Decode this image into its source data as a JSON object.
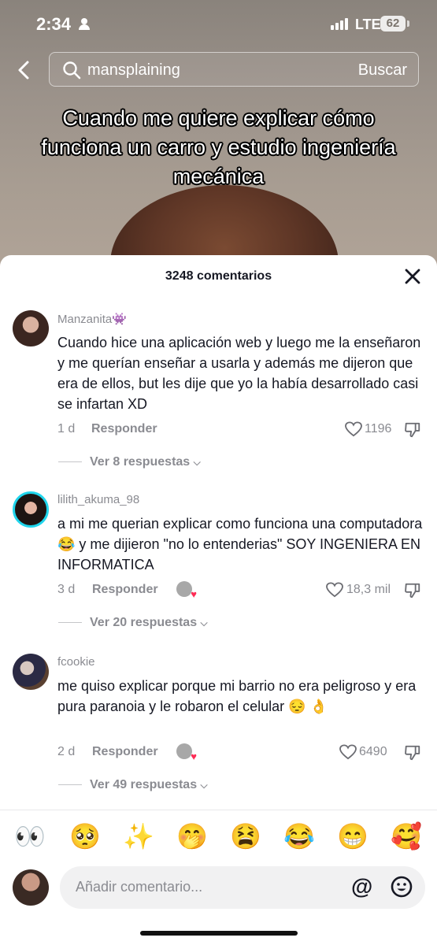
{
  "status_bar": {
    "time": "2:34",
    "network": "LTE",
    "battery": "62"
  },
  "search": {
    "query": "mansplaining",
    "button_label": "Buscar"
  },
  "video": {
    "caption": "Cuando me quiere explicar cómo funciona un carro y estudio ingeniería mecánica"
  },
  "comments_panel": {
    "title": "3248 comentarios",
    "comments": [
      {
        "username": "Manzanita👾",
        "text": "Cuando hice una aplicación web y luego me la enseñaron y me querían enseñar a usarla y además me dijeron que era de ellos, but les dije que yo la había desarrollado casi se infartan XD",
        "age": "1 d",
        "reply_label": "Responder",
        "likes": "1196",
        "view_replies": "Ver 8 respuestas"
      },
      {
        "username": "lilith_akuma_98",
        "text": "a mi me querian explicar como funciona una computadora 😂 y me dijieron \"no lo entenderias\" SOY INGENIERA EN INFORMATICA",
        "age": "3 d",
        "reply_label": "Responder",
        "likes": "18,3 mil",
        "view_replies": "Ver 20 respuestas"
      },
      {
        "username": "fcookie",
        "text": "me quiso explicar porque mi barrio no era peligroso y era pura paranoia y le robaron el celular 😔 👌",
        "age": "2 d",
        "reply_label": "Responder",
        "likes": "6490",
        "view_replies": "Ver 49 respuestas"
      }
    ]
  },
  "emoji_bar": [
    "👀",
    "🥺",
    "✨",
    "🤭",
    "😫",
    "😂",
    "😁",
    "🥰"
  ],
  "comment_input": {
    "placeholder": "Añadir comentario...",
    "mention_label": "@"
  }
}
